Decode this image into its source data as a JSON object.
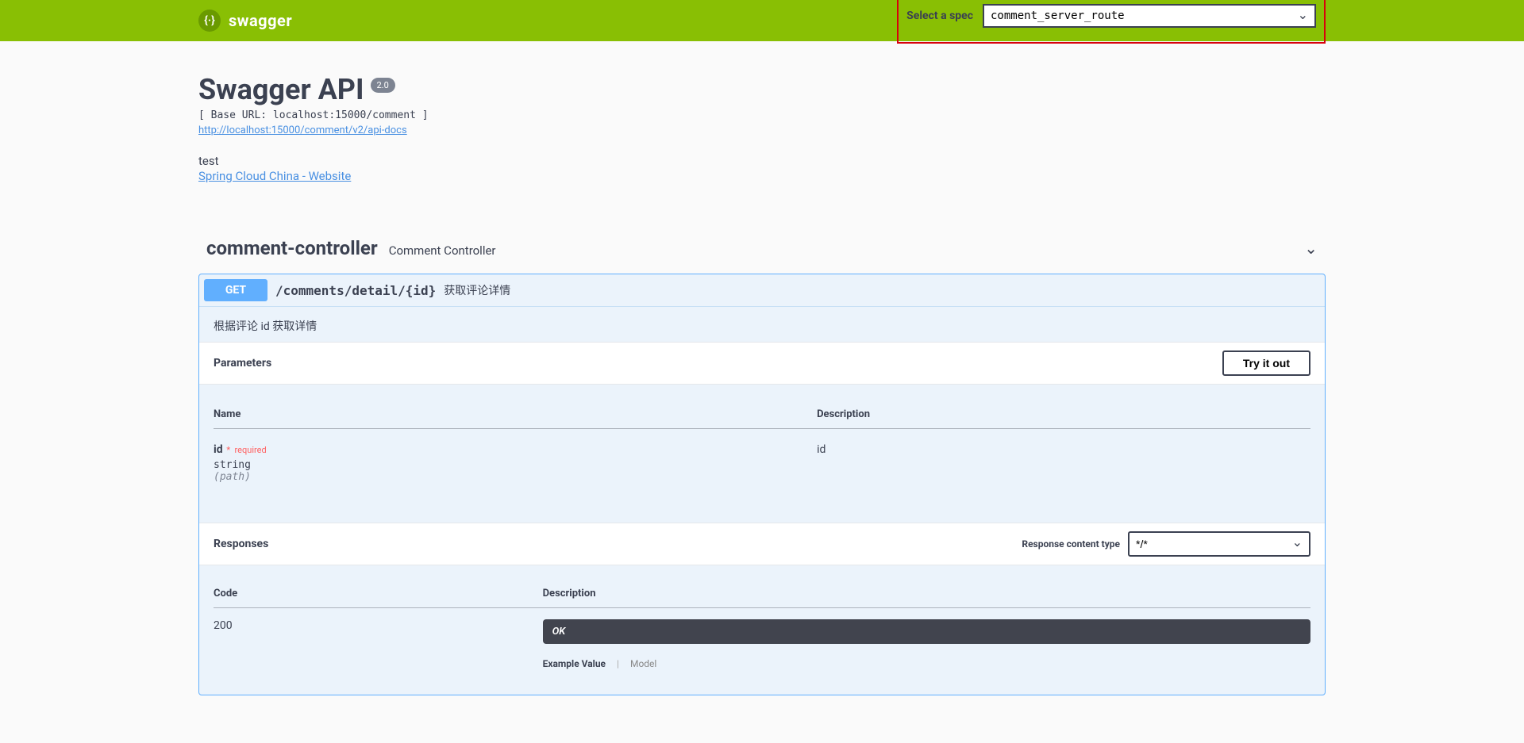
{
  "topbar": {
    "logo_text": "swagger",
    "spec_label": "Select a spec",
    "spec_selected": "comment_server_route"
  },
  "info": {
    "title": "Swagger API",
    "version": "2.0",
    "base_url_line": "[ Base URL: localhost:15000/comment ]",
    "docs_url": "http://localhost:15000/comment/v2/api-docs",
    "description": "test",
    "website_label": "Spring Cloud China - Website"
  },
  "tag": {
    "name": "comment-controller",
    "description": "Comment Controller"
  },
  "operation": {
    "method": "GET",
    "path": "/comments/detail/{id}",
    "summary": "获取评论详情",
    "description": "根据评论 id 获取详情",
    "parameters_label": "Parameters",
    "try_label": "Try it out",
    "col_name": "Name",
    "col_desc": "Description",
    "param": {
      "name": "id",
      "required_label": "required",
      "type": "string",
      "in_label": "(path)",
      "description": "id"
    },
    "responses_label": "Responses",
    "content_type_label": "Response content type",
    "content_type_value": "*/*",
    "resp_col_code": "Code",
    "resp_col_desc": "Description",
    "resp": {
      "code": "200",
      "desc": "OK"
    },
    "tab_example": "Example Value",
    "tab_model": "Model"
  }
}
